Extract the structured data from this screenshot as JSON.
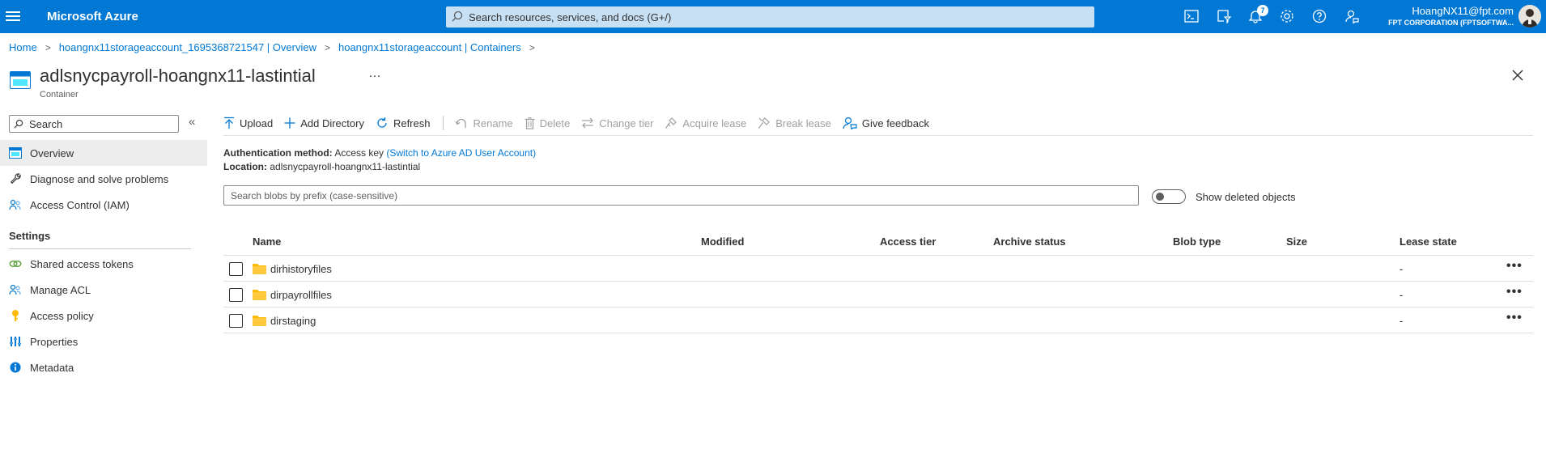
{
  "topbar": {
    "brand": "Microsoft Azure",
    "search_placeholder": "Search resources, services, and docs (G+/)",
    "notification_count": "7",
    "user": "HoangNX11@fpt.com",
    "org": "FPT CORPORATION (FPTSOFTWA...",
    "icons": [
      "cloud-shell-icon",
      "directory-filter-icon",
      "bell-icon",
      "gear-icon",
      "help-icon",
      "feedback-icon"
    ]
  },
  "breadcrumb": [
    "Home",
    "hoangnx11storageaccount_1695368721547 | Overview",
    "hoangnx11storageaccount | Containers"
  ],
  "header": {
    "title": "adlsnycpayroll-hoangnx11-lastintial",
    "subtitle": "Container",
    "more": "…"
  },
  "sidebar": {
    "search_placeholder": "Search",
    "collapse": "«",
    "items": [
      {
        "label": "Overview",
        "icon": "container-icon"
      },
      {
        "label": "Diagnose and solve problems",
        "icon": "wrench-icon"
      },
      {
        "label": "Access Control (IAM)",
        "icon": "people-icon"
      }
    ],
    "section": "Settings",
    "settings_items": [
      {
        "label": "Shared access tokens",
        "icon": "link-icon"
      },
      {
        "label": "Manage ACL",
        "icon": "people-icon"
      },
      {
        "label": "Access policy",
        "icon": "key-icon"
      },
      {
        "label": "Properties",
        "icon": "properties-icon"
      },
      {
        "label": "Metadata",
        "icon": "info-icon"
      }
    ]
  },
  "toolbar": {
    "upload": "Upload",
    "add_directory": "Add Directory",
    "refresh": "Refresh",
    "rename": "Rename",
    "delete": "Delete",
    "change_tier": "Change tier",
    "acquire_lease": "Acquire lease",
    "break_lease": "Break lease",
    "give_feedback": "Give feedback"
  },
  "info": {
    "auth_label": "Authentication method:",
    "auth_value": "Access key",
    "auth_link": "(Switch to Azure AD User Account)",
    "location_label": "Location:",
    "location_value": "adlsnycpayroll-hoangnx11-lastintial"
  },
  "filter": {
    "placeholder": "Search blobs by prefix (case-sensitive)",
    "toggle_label": "Show deleted objects"
  },
  "table": {
    "columns": [
      "Name",
      "Modified",
      "Access tier",
      "Archive status",
      "Blob type",
      "Size",
      "Lease state"
    ],
    "rows": [
      {
        "name": "dirhistoryfiles",
        "lease": "-",
        "more": "•••"
      },
      {
        "name": "dirpayrollfiles",
        "lease": "-",
        "more": "•••"
      },
      {
        "name": "dirstaging",
        "lease": "-",
        "more": "•••"
      }
    ]
  },
  "colors": {
    "brand_blue": "#0078d4",
    "folder_yellow": "#ffb900"
  }
}
